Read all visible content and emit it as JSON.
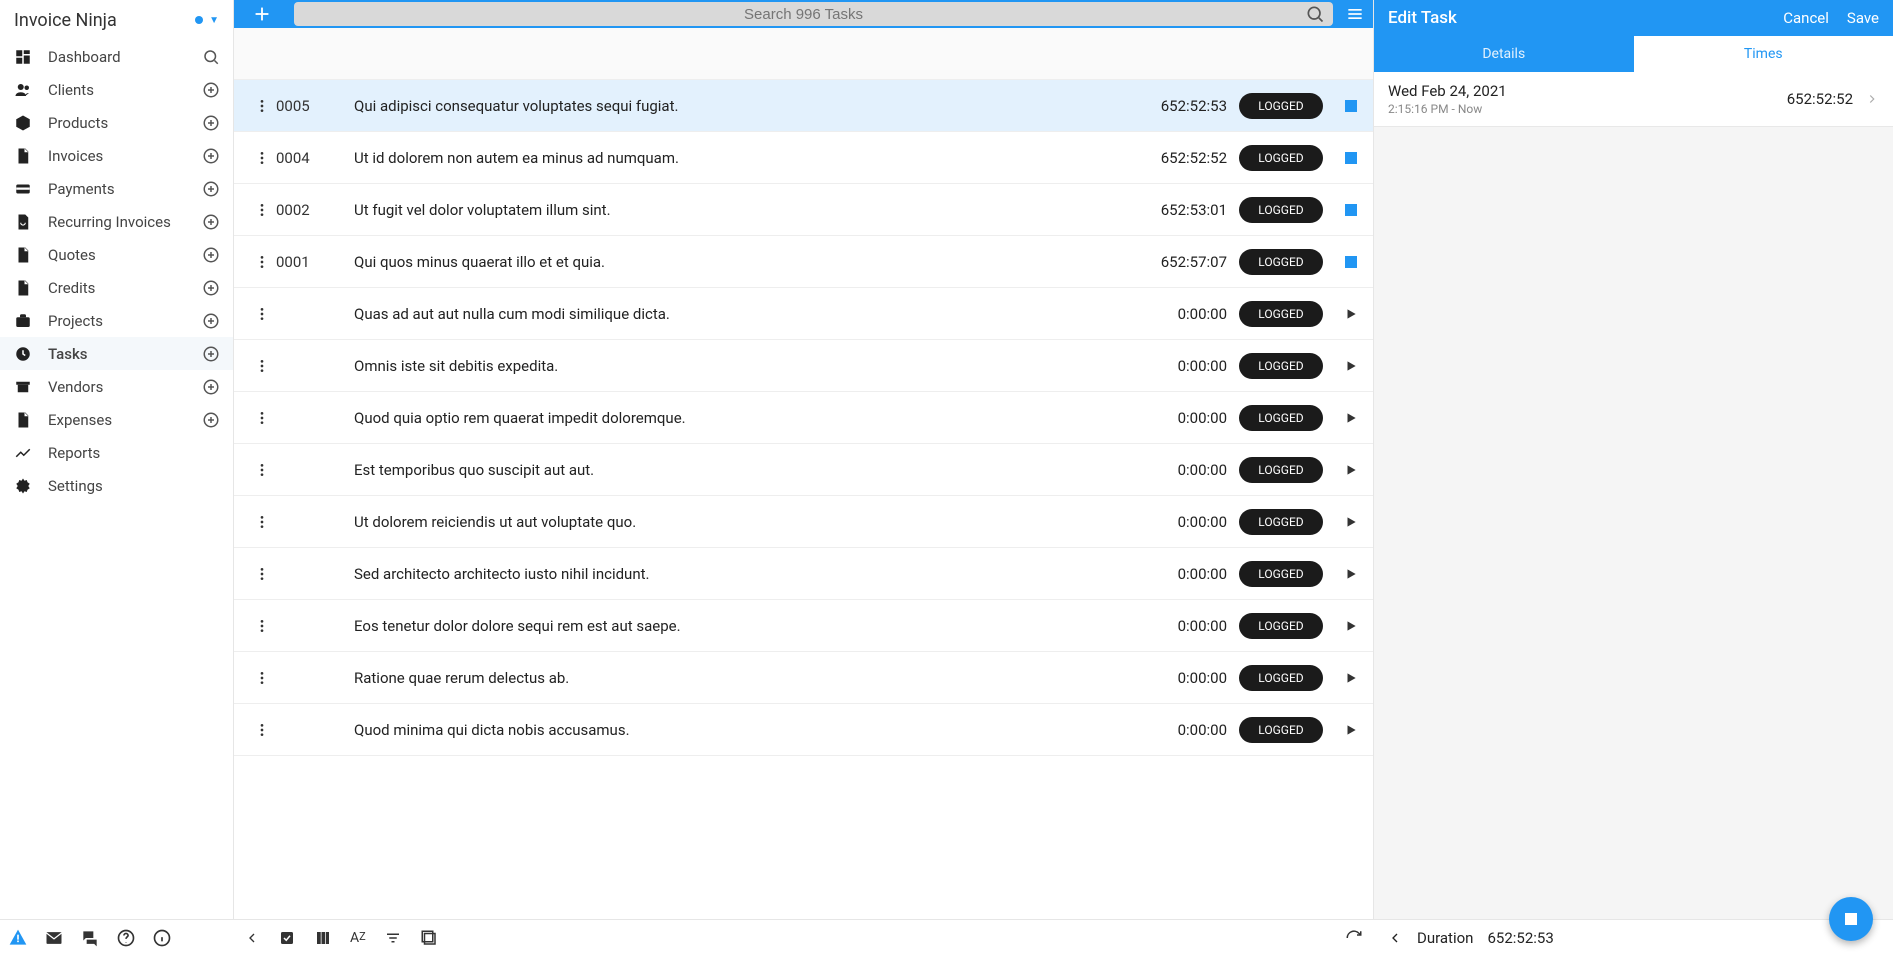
{
  "brand": "Invoice Ninja",
  "sidebar": {
    "items": [
      {
        "label": "Dashboard"
      },
      {
        "label": "Clients"
      },
      {
        "label": "Products"
      },
      {
        "label": "Invoices"
      },
      {
        "label": "Payments"
      },
      {
        "label": "Recurring Invoices"
      },
      {
        "label": "Quotes"
      },
      {
        "label": "Credits"
      },
      {
        "label": "Projects"
      },
      {
        "label": "Tasks"
      },
      {
        "label": "Vendors"
      },
      {
        "label": "Expenses"
      },
      {
        "label": "Reports"
      },
      {
        "label": "Settings"
      }
    ]
  },
  "search": {
    "placeholder": "Search 996 Tasks"
  },
  "tasks": [
    {
      "num": "0005",
      "desc": "Qui adipisci consequatur voluptates sequi fugiat.",
      "time": "652:52:53",
      "status": "LOGGED",
      "running": true,
      "selected": true
    },
    {
      "num": "0004",
      "desc": "Ut id dolorem non autem ea minus ad numquam.",
      "time": "652:52:52",
      "status": "LOGGED",
      "running": true
    },
    {
      "num": "0002",
      "desc": "Ut fugit vel dolor voluptatem illum sint.",
      "time": "652:53:01",
      "status": "LOGGED",
      "running": true
    },
    {
      "num": "0001",
      "desc": "Qui quos minus quaerat illo et et quia.",
      "time": "652:57:07",
      "status": "LOGGED",
      "running": true
    },
    {
      "num": "",
      "desc": "Quas ad aut aut nulla cum modi similique dicta.",
      "time": "0:00:00",
      "status": "LOGGED",
      "running": false
    },
    {
      "num": "",
      "desc": "Omnis iste sit debitis expedita.",
      "time": "0:00:00",
      "status": "LOGGED",
      "running": false
    },
    {
      "num": "",
      "desc": "Quod quia optio rem quaerat impedit doloremque.",
      "time": "0:00:00",
      "status": "LOGGED",
      "running": false
    },
    {
      "num": "",
      "desc": "Est temporibus quo suscipit aut aut.",
      "time": "0:00:00",
      "status": "LOGGED",
      "running": false
    },
    {
      "num": "",
      "desc": "Ut dolorem reiciendis ut aut voluptate quo.",
      "time": "0:00:00",
      "status": "LOGGED",
      "running": false
    },
    {
      "num": "",
      "desc": "Sed architecto architecto iusto nihil incidunt.",
      "time": "0:00:00",
      "status": "LOGGED",
      "running": false
    },
    {
      "num": "",
      "desc": "Eos tenetur dolor dolore sequi rem est aut saepe.",
      "time": "0:00:00",
      "status": "LOGGED",
      "running": false
    },
    {
      "num": "",
      "desc": "Ratione quae rerum delectus ab.",
      "time": "0:00:00",
      "status": "LOGGED",
      "running": false
    },
    {
      "num": "",
      "desc": "Quod minima qui dicta nobis accusamus.",
      "time": "0:00:00",
      "status": "LOGGED",
      "running": false
    }
  ],
  "edit": {
    "title": "Edit Task",
    "cancel": "Cancel",
    "save": "Save",
    "tabs": {
      "details": "Details",
      "times": "Times"
    },
    "time_entry": {
      "date": "Wed Feb 24, 2021",
      "range": "2:15:16 PM - Now",
      "duration": "652:52:52"
    }
  },
  "bottom": {
    "duration_label": "Duration",
    "duration_value": "652:52:53"
  }
}
